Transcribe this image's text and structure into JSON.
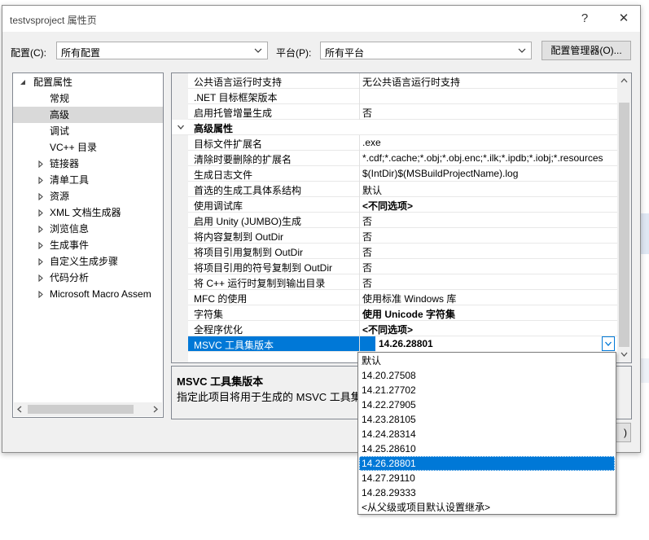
{
  "window": {
    "title": "testvsproject 属性页",
    "help": "?",
    "close": "✕"
  },
  "toolbar": {
    "config_label": "配置(C):",
    "config_value": "所有配置",
    "platform_label": "平台(P):",
    "platform_value": "所有平台",
    "config_manager": "配置管理器(O)..."
  },
  "tree": {
    "root": "配置属性",
    "items": [
      {
        "label": "常规",
        "expandable": false
      },
      {
        "label": "高级",
        "expandable": false,
        "selected": true
      },
      {
        "label": "调试",
        "expandable": false
      },
      {
        "label": "VC++ 目录",
        "expandable": false
      },
      {
        "label": "链接器",
        "expandable": true
      },
      {
        "label": "清单工具",
        "expandable": true
      },
      {
        "label": "资源",
        "expandable": true
      },
      {
        "label": "XML 文档生成器",
        "expandable": true
      },
      {
        "label": "浏览信息",
        "expandable": true
      },
      {
        "label": "生成事件",
        "expandable": true
      },
      {
        "label": "自定义生成步骤",
        "expandable": true
      },
      {
        "label": "代码分析",
        "expandable": true
      },
      {
        "label": "Microsoft Macro Assem",
        "expandable": true
      }
    ]
  },
  "grid": {
    "rows_top": [
      {
        "name": "公共语言运行时支持",
        "value": "无公共语言运行时支持"
      },
      {
        "name": ".NET 目标框架版本",
        "value": ""
      },
      {
        "name": "启用托管增量生成",
        "value": "否"
      }
    ],
    "category": "高级属性",
    "rows": [
      {
        "name": "目标文件扩展名",
        "value": ".exe"
      },
      {
        "name": "清除时要删除的扩展名",
        "value": "*.cdf;*.cache;*.obj;*.obj.enc;*.ilk;*.ipdb;*.iobj;*.resources"
      },
      {
        "name": "生成日志文件",
        "value": "$(IntDir)$(MSBuildProjectName).log"
      },
      {
        "name": "首选的生成工具体系结构",
        "value": "默认"
      },
      {
        "name": "使用调试库",
        "value": "<不同选项>",
        "bold": true
      },
      {
        "name": "启用 Unity (JUMBO)生成",
        "value": "否"
      },
      {
        "name": "将内容复制到 OutDir",
        "value": "否"
      },
      {
        "name": "将项目引用复制到 OutDir",
        "value": "否"
      },
      {
        "name": "将项目引用的符号复制到 OutDir",
        "value": "否"
      },
      {
        "name": "将 C++ 运行时复制到输出目录",
        "value": "否"
      },
      {
        "name": "MFC 的使用",
        "value": "使用标准 Windows 库"
      },
      {
        "name": "字符集",
        "value": "使用 Unicode 字符集",
        "bold": true
      },
      {
        "name": "全程序优化",
        "value": "<不同选项>",
        "bold": true
      }
    ],
    "selected_row": {
      "name": "MSVC 工具集版本",
      "value": "14.26.28801"
    }
  },
  "description": {
    "title": "MSVC 工具集版本",
    "text": "指定此项目将用于生成的 MSVC 工具集"
  },
  "dropdown": {
    "options": [
      "默认",
      "14.20.27508",
      "14.21.27702",
      "14.22.27905",
      "14.23.28105",
      "14.24.28314",
      "14.25.28610",
      "14.26.28801",
      "14.27.29110",
      "14.28.29333",
      "<从父级或项目默认设置继承>"
    ],
    "selected_index": 7
  },
  "hidden_button_fragment": ")"
}
